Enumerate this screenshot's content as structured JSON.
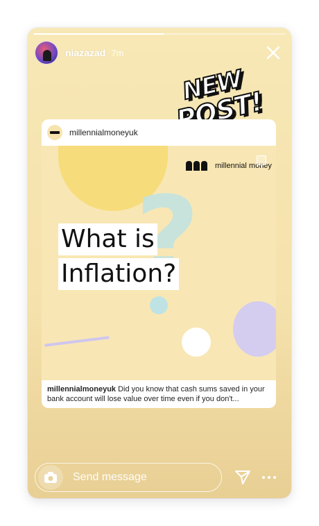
{
  "story": {
    "username": "niazazad",
    "time": "7m",
    "progress": 0.52
  },
  "sticker": {
    "line1": "NEW",
    "line2": "POST!"
  },
  "post": {
    "account": "millennialmoneyuk",
    "brand": "millennial money",
    "title_line1": "What is",
    "title_line2": "Inflation?",
    "caption_user": "millennialmoneyuk",
    "caption_text": "Did you know that cash sums saved in your bank account will lose value over time even if you don't..."
  },
  "footer": {
    "placeholder": "Send message"
  },
  "icons": {
    "close": "close-icon",
    "camera": "camera-icon",
    "send": "send-icon",
    "more": "more-icon"
  },
  "colors": {
    "background": "#f6e3ae",
    "accent_lilac": "#d4cdf0",
    "accent_teal": "#bfe3e4",
    "accent_yellow": "#f6da74"
  }
}
